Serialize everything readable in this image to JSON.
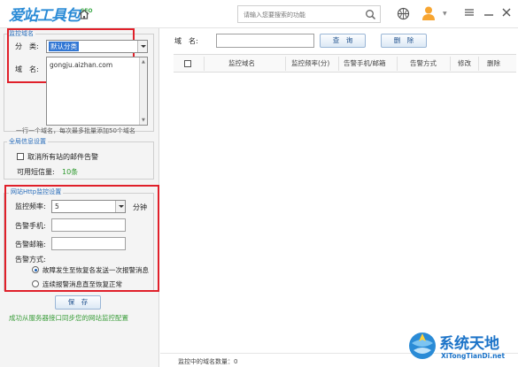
{
  "app": {
    "logo_text": "爱站工具包",
    "logo_badge": "SEO"
  },
  "top": {
    "search_placeholder": "请输入您要搜索的功能"
  },
  "monitor_domain": {
    "title": "监控域名",
    "category_label": "分　类:",
    "category_value": "默认分类",
    "domain_label": "域　名:",
    "domain_value": "gongju.aizhan.com",
    "hint": "一行一个域名，每次最多批量添加50个域名"
  },
  "global": {
    "title": "全局信息设置",
    "cancel_alerts": "取消所有站的邮件告警",
    "sms_label": "可用短信量:",
    "sms_value": "10条"
  },
  "http": {
    "title": "网站Http监控设置",
    "freq_label": "监控频率:",
    "freq_value": "5",
    "freq_unit": "分钟",
    "phone_label": "告警手机:",
    "email_label": "告警邮箱:",
    "mode_label": "告警方式:",
    "mode_option1": "故障发生至恢复各发送一次报警消息",
    "mode_option2": "连续报警消息直至恢复正常"
  },
  "save_label": "保　存",
  "sync_link": "成功从服务器接口同步您的网站监控配置",
  "right": {
    "domain_label": "域　名:",
    "query_label": "查　询",
    "delete_label": "删　除",
    "columns": [
      "监控域名",
      "监控频率(分)",
      "告警手机/邮箱",
      "告警方式",
      "修改",
      "删除"
    ],
    "status": "监控中的域名数量：0"
  },
  "watermark": {
    "title": "系统天地",
    "url": "XiTongTianDi.net"
  },
  "colors": {
    "accent": "#2a8bd6",
    "highlight": "#e0202a",
    "link": "#3a9d3a",
    "selection": "#3277d4"
  }
}
